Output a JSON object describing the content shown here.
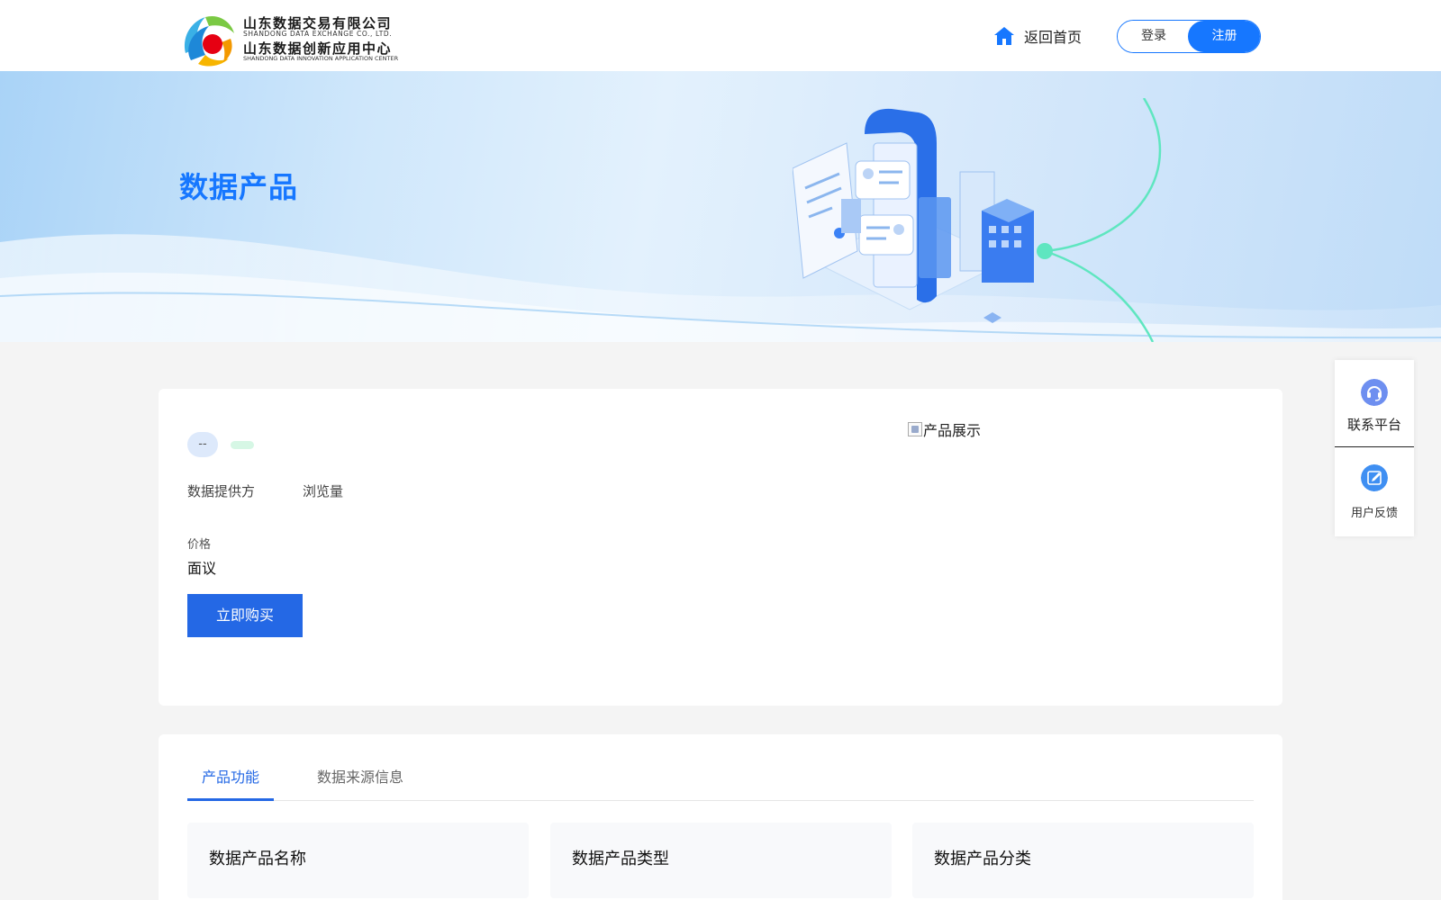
{
  "header": {
    "logo": {
      "cn_line1": "山东数据交易有限公司",
      "en_line1": "SHANDONG DATA EXCHANGE CO., LTD.",
      "cn_line2": "山东数据创新应用中心",
      "en_line2": "SHANDONG DATA INNOVATION APPLICATION CENTER"
    },
    "home_label": "返回首页",
    "login_label": "登录",
    "register_label": "注册",
    "accent_color": "#1677ff"
  },
  "banner": {
    "title": "数据产品"
  },
  "product": {
    "tag_primary": "--",
    "provider_label": "数据提供方",
    "views_label": "浏览量",
    "price_label": "价格",
    "price_value": "面议",
    "buy_label": "立即购买",
    "image_alt": "产品展示"
  },
  "side_float": {
    "contact_label": "联系平台",
    "feedback_label": "用户反馈"
  },
  "info_section": {
    "tabs": [
      {
        "label": "产品功能",
        "active": true
      },
      {
        "label": "数据来源信息",
        "active": false
      }
    ],
    "fields": [
      {
        "label": "数据产品名称"
      },
      {
        "label": "数据产品类型"
      },
      {
        "label": "数据产品分类"
      }
    ]
  }
}
